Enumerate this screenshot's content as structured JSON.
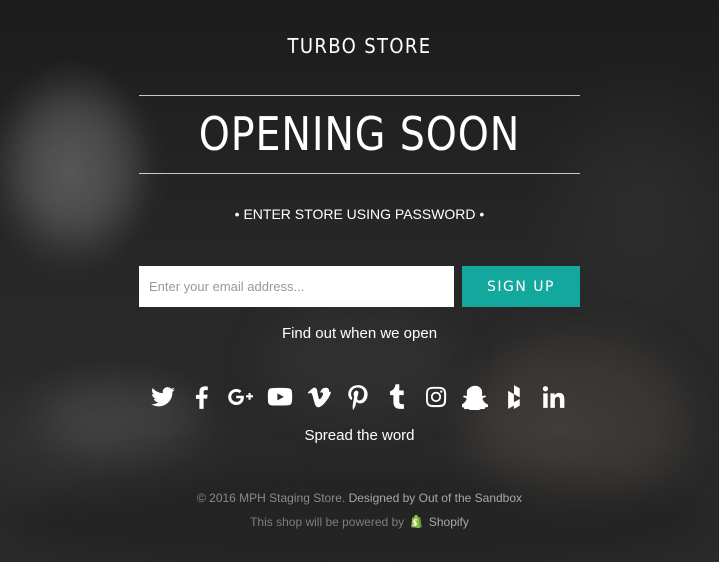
{
  "store": {
    "name": "TURBO STORE"
  },
  "headline": "OPENING SOON",
  "password_link": "• ENTER STORE USING PASSWORD •",
  "signup": {
    "email_placeholder": "Enter your email address...",
    "button_label": "SIGN UP",
    "note": "Find out when we open"
  },
  "social": {
    "icons": [
      "twitter-icon",
      "facebook-icon",
      "google-plus-icon",
      "youtube-icon",
      "vimeo-icon",
      "pinterest-icon",
      "tumblr-icon",
      "instagram-icon",
      "snapchat-icon",
      "houzz-icon",
      "linkedin-icon"
    ],
    "caption": "Spread the word"
  },
  "footer": {
    "copyright": "© 2016 MPH Staging Store.",
    "designed_by": "Designed by Out of the Sandbox",
    "powered_prefix": "This shop will be powered by",
    "powered_brand": "Shopify"
  },
  "colors": {
    "accent": "#13a89e",
    "text": "#ffffff",
    "muted": "#8a8a8a"
  }
}
